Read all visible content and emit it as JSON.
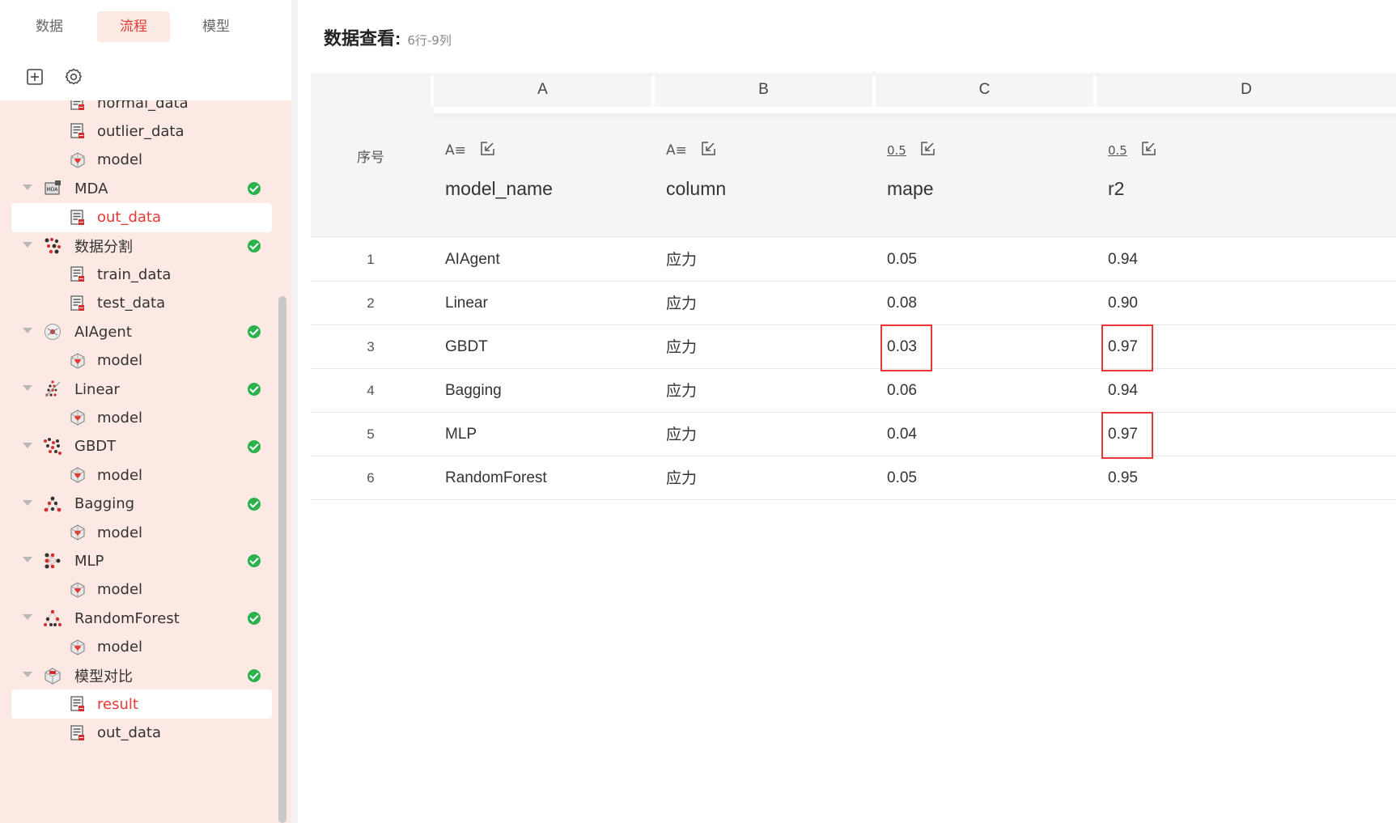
{
  "sidebar": {
    "tabs": [
      {
        "label": "数据",
        "active": false
      },
      {
        "label": "流程",
        "active": true
      },
      {
        "label": "模型",
        "active": false
      }
    ],
    "toolbar": {
      "add_icon": "add-square-icon",
      "settings_icon": "gear-icon"
    },
    "tree": [
      {
        "type": "child",
        "label": "normal_data",
        "icon": "dataset-icon"
      },
      {
        "type": "child",
        "label": "outlier_data",
        "icon": "dataset-icon"
      },
      {
        "type": "child",
        "label": "model",
        "icon": "model-icon"
      },
      {
        "type": "node",
        "label": "MDA",
        "icon": "mda-node-icon",
        "status": "success"
      },
      {
        "type": "child",
        "label": "out_data",
        "icon": "dataset-icon",
        "selected": true
      },
      {
        "type": "node",
        "label": "数据分割",
        "icon": "split-node-icon",
        "status": "success"
      },
      {
        "type": "child",
        "label": "train_data",
        "icon": "dataset-icon"
      },
      {
        "type": "child",
        "label": "test_data",
        "icon": "dataset-icon"
      },
      {
        "type": "node",
        "label": "AIAgent",
        "icon": "agent-node-icon",
        "status": "success"
      },
      {
        "type": "child",
        "label": "model",
        "icon": "model-icon"
      },
      {
        "type": "node",
        "label": "Linear",
        "icon": "linear-node-icon",
        "status": "success"
      },
      {
        "type": "child",
        "label": "model",
        "icon": "model-icon"
      },
      {
        "type": "node",
        "label": "GBDT",
        "icon": "gbdt-node-icon",
        "status": "success"
      },
      {
        "type": "child",
        "label": "model",
        "icon": "model-icon"
      },
      {
        "type": "node",
        "label": "Bagging",
        "icon": "bagging-node-icon",
        "status": "success"
      },
      {
        "type": "child",
        "label": "model",
        "icon": "model-icon"
      },
      {
        "type": "node",
        "label": "MLP",
        "icon": "mlp-node-icon",
        "status": "success"
      },
      {
        "type": "child",
        "label": "model",
        "icon": "model-icon"
      },
      {
        "type": "node",
        "label": "RandomForest",
        "icon": "randomforest-node-icon",
        "status": "success"
      },
      {
        "type": "child",
        "label": "model",
        "icon": "model-icon"
      },
      {
        "type": "node",
        "label": "模型对比",
        "icon": "compare-node-icon",
        "status": "success"
      },
      {
        "type": "child",
        "label": "result",
        "icon": "dataset-icon",
        "selected": true
      },
      {
        "type": "child",
        "label": "out_data",
        "icon": "dataset-icon"
      }
    ]
  },
  "main": {
    "title": "数据查看",
    "title_colon": ":",
    "meta": "6行-9列",
    "seq_label": "序号",
    "columns": [
      {
        "letter": "A",
        "name": "model_name",
        "type_label": "A≡",
        "type": "text"
      },
      {
        "letter": "B",
        "name": "column",
        "type_label": "A≡",
        "type": "text"
      },
      {
        "letter": "C",
        "name": "mape",
        "type_label": "0.5",
        "type": "number"
      },
      {
        "letter": "D",
        "name": "r2",
        "type_label": "0.5",
        "type": "number"
      }
    ],
    "rows": [
      {
        "idx": "1",
        "cells": [
          "AIAgent",
          "应力",
          "0.05",
          "0.94"
        ]
      },
      {
        "idx": "2",
        "cells": [
          "Linear",
          "应力",
          "0.08",
          "0.90"
        ]
      },
      {
        "idx": "3",
        "cells": [
          "GBDT",
          "应力",
          "0.03",
          "0.97"
        ]
      },
      {
        "idx": "4",
        "cells": [
          "Bagging",
          "应力",
          "0.06",
          "0.94"
        ]
      },
      {
        "idx": "5",
        "cells": [
          "MLP",
          "应力",
          "0.04",
          "0.97"
        ]
      },
      {
        "idx": "6",
        "cells": [
          "RandomForest",
          "应力",
          "0.05",
          "0.95"
        ]
      }
    ],
    "highlights": [
      {
        "row": 2,
        "col": 2
      },
      {
        "row": 2,
        "col": 3
      },
      {
        "row": 4,
        "col": 3
      }
    ]
  },
  "colors": {
    "accent": "#e53935",
    "sidebar_bg": "#fde9e4",
    "success": "#2bb24c",
    "highlight_border": "#e53935"
  }
}
